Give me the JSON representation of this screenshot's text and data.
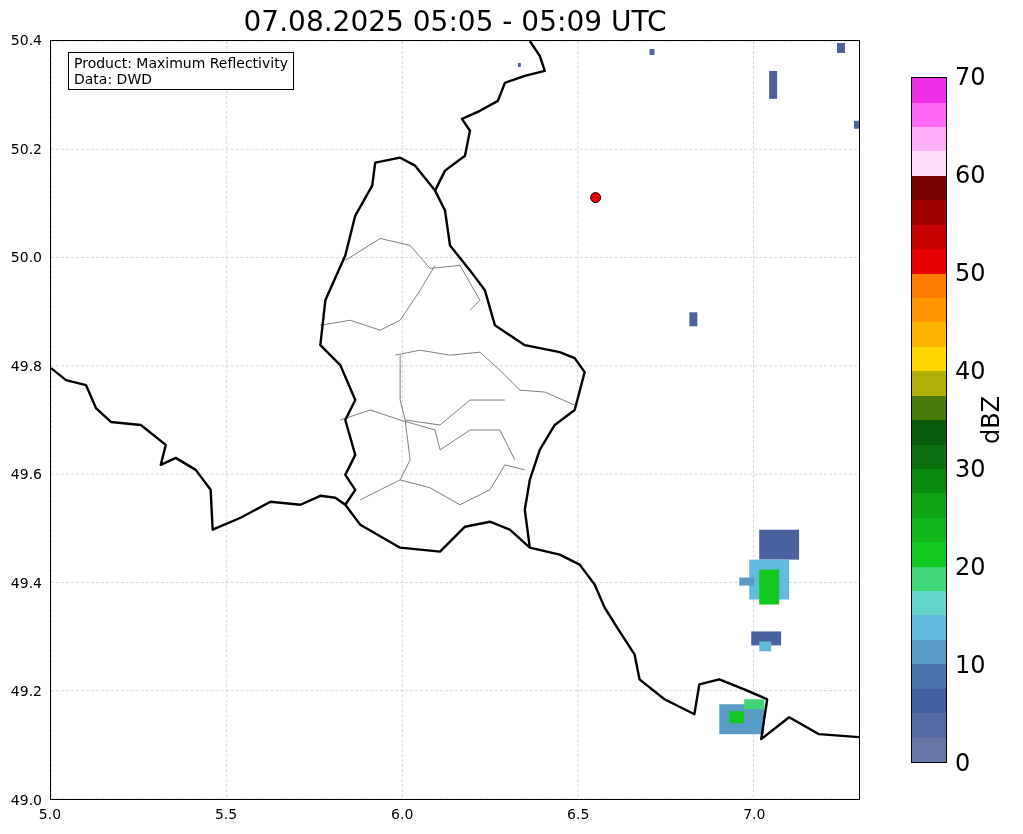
{
  "title": "07.08.2025 05:05 - 05:09 UTC",
  "info_box": {
    "lines": [
      "Product: Maximum Reflectivity",
      "Data: DWD"
    ]
  },
  "map": {
    "xticks": [
      "5.0",
      "5.5",
      "6.0",
      "6.5",
      "7.0"
    ],
    "yticks": [
      "50.4",
      "50.2",
      "50.0",
      "49.8",
      "49.6",
      "49.4",
      "49.2",
      "49.0"
    ]
  },
  "colorbar": {
    "label": "dBZ",
    "ticks": [
      "70",
      "60",
      "50",
      "40",
      "30",
      "20",
      "10",
      "0"
    ],
    "bands": [
      {
        "color": "#6577a6"
      },
      {
        "color": "#556aa3"
      },
      {
        "color": "#445fa2"
      },
      {
        "color": "#4a74ad"
      },
      {
        "color": "#5a9cc8"
      },
      {
        "color": "#62bbdc"
      },
      {
        "color": "#62d6c8"
      },
      {
        "color": "#3ed676"
      },
      {
        "color": "#12c91f"
      },
      {
        "color": "#12b81a"
      },
      {
        "color": "#0ea413"
      },
      {
        "color": "#0b8a12"
      },
      {
        "color": "#0a7010"
      },
      {
        "color": "#0a5a0c"
      },
      {
        "color": "#4a7a0a"
      },
      {
        "color": "#b0b00a"
      },
      {
        "color": "#ffd700"
      },
      {
        "color": "#ffb400"
      },
      {
        "color": "#ff9600"
      },
      {
        "color": "#ff7d00"
      },
      {
        "color": "#e60000"
      },
      {
        "color": "#c80000"
      },
      {
        "color": "#a00000"
      },
      {
        "color": "#780000"
      },
      {
        "color": "#ffdcf8"
      },
      {
        "color": "#ffaff8"
      },
      {
        "color": "#ff69f5"
      },
      {
        "color": "#ee2ee6"
      }
    ]
  }
}
